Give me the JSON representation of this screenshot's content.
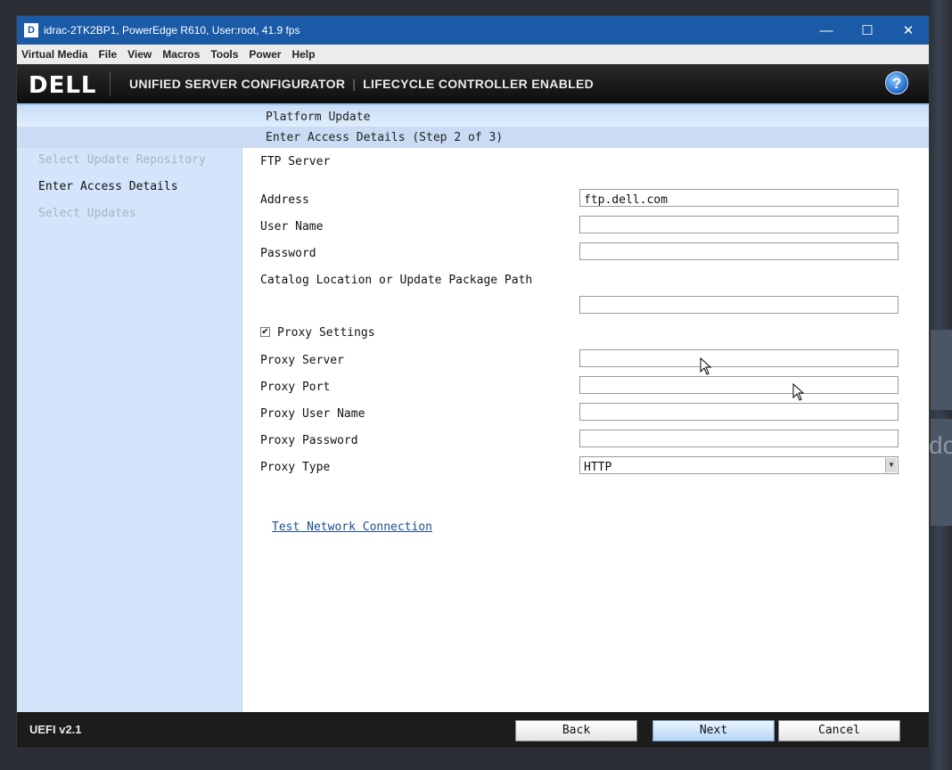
{
  "window": {
    "title": "idrac-2TK2BP1, PowerEdge R610, User:root, 41.9 fps",
    "app_icon_letter": "D",
    "controls": [
      "minimize-icon",
      "maximize-icon",
      "close-icon"
    ]
  },
  "menu": [
    "Virtual Media",
    "File",
    "View",
    "Macros",
    "Tools",
    "Power",
    "Help"
  ],
  "header": {
    "logo": "DELL",
    "title_left": "UNIFIED SERVER CONFIGURATOR",
    "title_right": "LIFECYCLE CONTROLLER ENABLED",
    "help_icon": "?"
  },
  "page": {
    "title": "Platform Update",
    "step_title": "Enter Access Details (Step 2 of 3)"
  },
  "steps": [
    {
      "label": "Select Update Repository",
      "state": "dim"
    },
    {
      "label": "Enter Access Details",
      "state": "active"
    },
    {
      "label": "Select Updates",
      "state": "dim"
    }
  ],
  "form": {
    "section": "FTP Server",
    "address": {
      "label": "Address",
      "value": "ftp.dell.com"
    },
    "user_name": {
      "label": "User Name",
      "value": ""
    },
    "password": {
      "label": "Password",
      "value": ""
    },
    "catalog": {
      "label": "Catalog Location or Update Package Path",
      "value": ""
    },
    "proxy_settings": {
      "label": "Proxy Settings",
      "checked": true,
      "mark": "✔"
    },
    "proxy_server": {
      "label": "Proxy Server",
      "value": ""
    },
    "proxy_port": {
      "label": "Proxy Port",
      "value": ""
    },
    "proxy_user": {
      "label": "Proxy User Name",
      "value": ""
    },
    "proxy_password": {
      "label": "Proxy Password",
      "value": ""
    },
    "proxy_type": {
      "label": "Proxy Type",
      "value": "HTTP"
    },
    "test_link": "Test Network Connection"
  },
  "footer": {
    "version": "UEFI v2.1",
    "back": "Back",
    "next": "Next",
    "cancel": "Cancel"
  },
  "desktop_glyph": "do"
}
